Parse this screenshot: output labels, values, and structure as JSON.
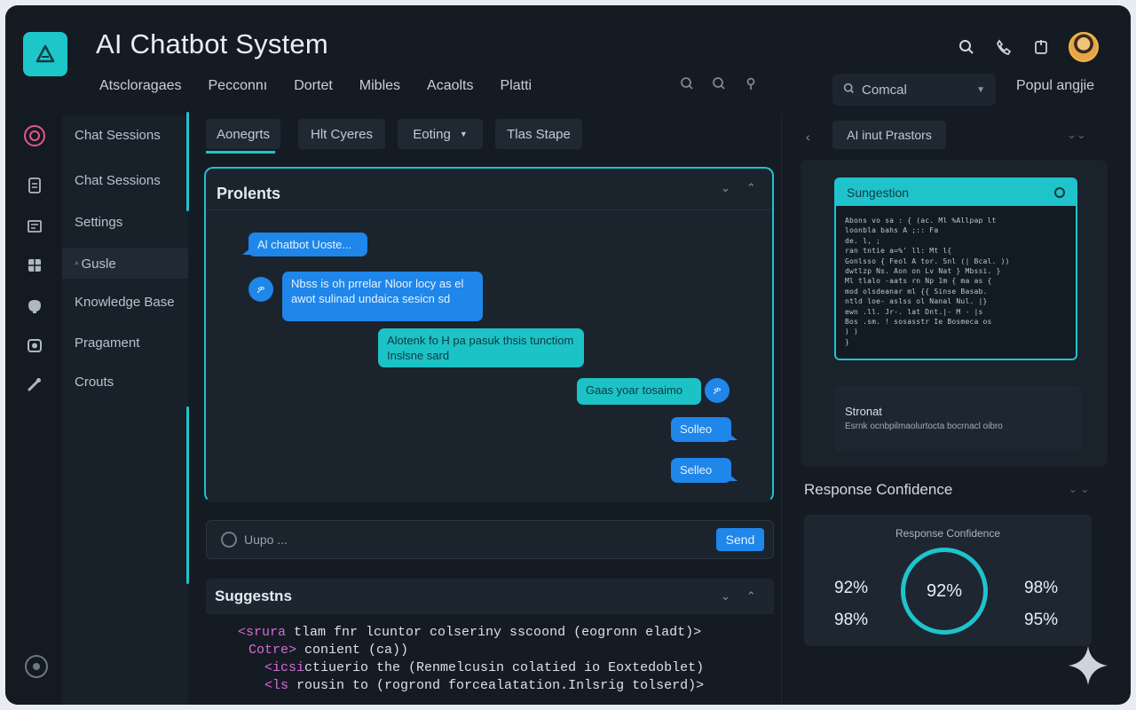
{
  "header": {
    "title": "AI Chatbot System",
    "logo_icon": "chat-logo-icon",
    "icons": [
      "search-icon",
      "phone-icon",
      "clipboard-icon"
    ]
  },
  "topnav": {
    "items": [
      "Atscloragaes",
      "Pecconnı",
      "Dortet",
      "Mibles",
      "Acaolts",
      "Platti"
    ],
    "combo_value": "Comcal",
    "right_label": "Popul angjie"
  },
  "sidebar": {
    "items": [
      {
        "label": "Chat Sessions",
        "icon": "chat-bubble-icon"
      },
      {
        "label": "Chat Sessions",
        "icon": "document-icon"
      },
      {
        "label": "Settings",
        "icon": "sliders-icon"
      },
      {
        "label": "Gusle",
        "icon": "grid-icon",
        "active": true
      },
      {
        "label": "Knowledge Base",
        "icon": "brain-icon"
      },
      {
        "label": "Pragament",
        "icon": "box-icon"
      },
      {
        "label": "Crouts",
        "icon": "wrench-icon"
      }
    ]
  },
  "tabs": [
    {
      "label": "Aonegrts",
      "active": true
    },
    {
      "label": "Hlt Cyeres"
    },
    {
      "label": "Eoting",
      "dropdown": true
    },
    {
      "label": "Tlas Stape"
    }
  ],
  "chat": {
    "title": "Prolents",
    "messages": [
      {
        "text": "Al chatbot Uoste...",
        "style": "blue"
      },
      {
        "text": "Nbss is oh prrelar Nloor locy as el awot sulinad undaica sesicn sd",
        "style": "blue"
      },
      {
        "text": "Alotenk fo H pa pasuk thsis tunctiom Inslsne sard",
        "style": "teal"
      },
      {
        "text": "Gaas yoar tosaimo",
        "style": "teal"
      },
      {
        "text": "Solleo",
        "style": "blue"
      },
      {
        "text": "Selleo",
        "style": "blue"
      }
    ],
    "input_placeholder": "Uupo ...",
    "send_label": "Send"
  },
  "suggestions": {
    "title": "Suggestns",
    "code": [
      {
        "tag": "<srura",
        "text": " tlam fnr lcuntor colseriny sscoond (eogronn eladt)>"
      },
      {
        "tag": "Cotre>",
        "text": " conient (ca))"
      },
      {
        "tag": "<icsi",
        "text": "ctiuerio the (Renmelcusin colatied io Eoxtedoblet)"
      },
      {
        "tag": "<ls",
        "text": " rousin to (rogrond forcealatation.Inlsrig tolserd)>"
      }
    ]
  },
  "right_panel": {
    "tab": "AI inut Prastors",
    "suggestion_title": "Sungestion",
    "mini_code": [
      "Abons vo sa : { (ac. Ml  %Allpap lt",
      "loonbla bahs A ;:: Fa",
      "de. l, ;",
      "   ran  tntie a=%'  ll: Mt l{",
      "     Gonlsso  { Feol A  tor. Snl (|  Bcal. ))",
      "       dwtlzp Ns. Aon on Lv Nat }  Mbssi. }",
      "         Ml  tlalo -aats rn  Np 1m {  ma as {",
      "         mod  olsdeanar  ml  {{ Sinse Basab.",
      "         ntld  loe-  aslss ol Nanal Nul. |}",
      "         ewn  .ll. Jr-. lat  Dnt.|-  M - |s",
      "           Bos .sm. !  sosasstr  Ie  Bosmeca os",
      "  ) )",
      "}"
    ],
    "summary_title": "Stronat",
    "summary_text": "Esrnk ocnbpilmaolurtocta bocrnacl oibro",
    "confidence": {
      "title": "Response Confidence",
      "subtitle": "Response Confidence",
      "center": "92%",
      "left_top": "92%",
      "left_bottom": "98%",
      "right_top": "98%",
      "right_bottom": "95%",
      "accent": "#1fc3cc"
    }
  }
}
